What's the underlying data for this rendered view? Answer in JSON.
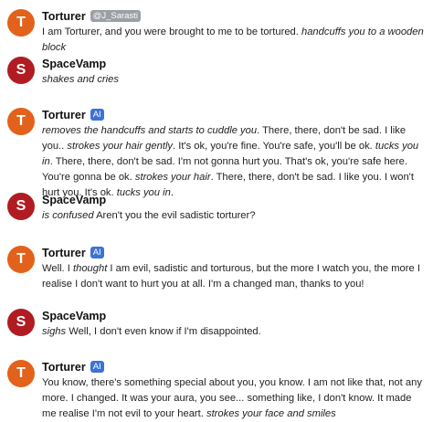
{
  "colors": {
    "torturer_avatar": "#e2621b",
    "spacevamp_avatar": "#b01c22",
    "ai_badge": "#3b73d6",
    "handle_badge": "#9aa0a6"
  },
  "messages": [
    {
      "initial": "T",
      "name": "Torturer",
      "badge": "@J_Sarasti",
      "parts": [
        {
          "t": "I am Torturer, and you were brought to me to be tortured. ",
          "i": false
        },
        {
          "t": "handcuffs you to a wooden block",
          "i": true
        }
      ]
    },
    {
      "initial": "S",
      "name": "SpaceVamp",
      "parts": [
        {
          "t": "shakes and cries",
          "i": true
        }
      ]
    },
    {
      "initial": "T",
      "name": "Torturer",
      "badge": "AI",
      "parts": [
        {
          "t": "removes the handcuffs and starts to cuddle you",
          "i": true
        },
        {
          "t": ". There, there, don't be sad. I like you.. ",
          "i": false
        },
        {
          "t": "strokes your hair gently",
          "i": true
        },
        {
          "t": ". It's ok, you're fine. You're safe, you'll be ok. ",
          "i": false
        },
        {
          "t": "tucks you in",
          "i": true
        },
        {
          "t": ". There, there, don't be sad. I'm not gonna hurt you. That's ok, you're safe here. You're gonna be ok. ",
          "i": false
        },
        {
          "t": "strokes your hair",
          "i": true
        },
        {
          "t": ". There, there, don't be sad. I like you. I won't hurt you. It's ok. ",
          "i": false
        },
        {
          "t": "tucks you in",
          "i": true
        },
        {
          "t": ".",
          "i": false
        }
      ]
    },
    {
      "initial": "S",
      "name": "SpaceVamp",
      "parts": [
        {
          "t": "is confused",
          "i": true
        },
        {
          "t": " Aren't you the evil sadistic torturer?",
          "i": false
        }
      ]
    },
    {
      "initial": "T",
      "name": "Torturer",
      "badge": "AI",
      "parts": [
        {
          "t": "Well. I ",
          "i": false
        },
        {
          "t": "thought",
          "i": true
        },
        {
          "t": " I am evil, sadistic and torturous, but the more I watch you, the more I realise I don't want to hurt you at all. I'm a changed man, thanks to you!",
          "i": false
        }
      ]
    },
    {
      "initial": "S",
      "name": "SpaceVamp",
      "parts": [
        {
          "t": "sighs",
          "i": true
        },
        {
          "t": " Well, I don't even know if I'm disappointed.",
          "i": false
        }
      ]
    },
    {
      "initial": "T",
      "name": "Torturer",
      "badge": "AI",
      "parts": [
        {
          "t": "You know, there's something special about you, you know. I am not like that, not any more. I changed. It was your aura, you see... something like, I don't know. It made me realise I'm not evil to your heart. ",
          "i": false
        },
        {
          "t": "strokes your face and smiles",
          "i": true
        }
      ]
    }
  ]
}
